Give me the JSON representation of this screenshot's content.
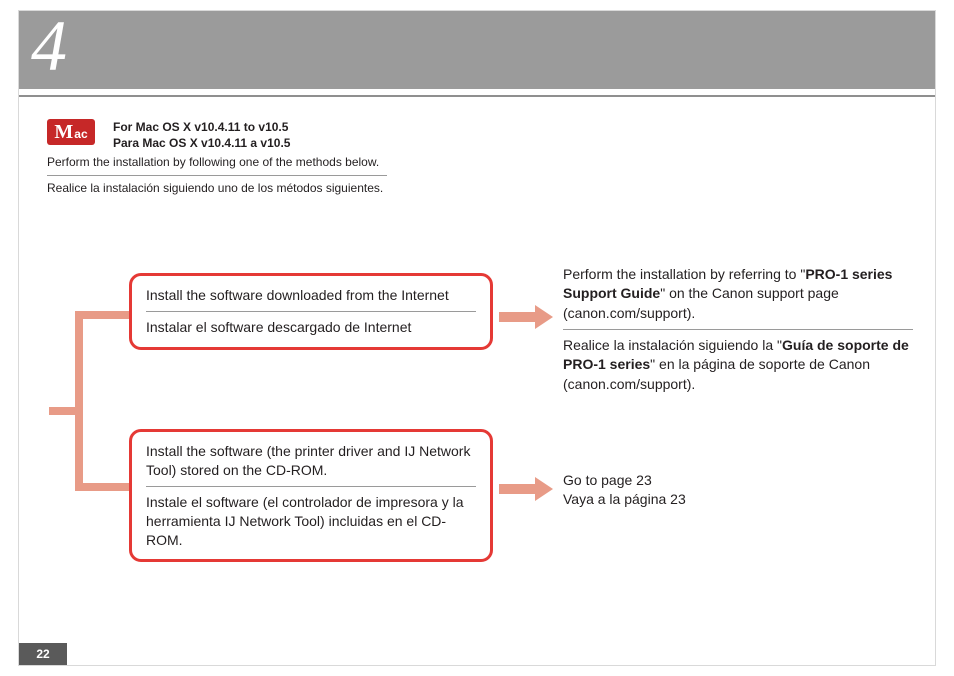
{
  "header": {
    "number": "4"
  },
  "mac_badge": {
    "M": "M",
    "ac": "ac"
  },
  "os": {
    "en": "For Mac OS X v10.4.11 to v10.5",
    "es": "Para Mac OS X v10.4.11 a v10.5"
  },
  "intro": {
    "en": "Perform the installation by following one of the methods below.",
    "es": "Realice la instalación siguiendo uno de los métodos siguientes."
  },
  "cards": {
    "top": {
      "en": "Install the software downloaded from the Internet",
      "es": "Instalar el software descargado de Internet"
    },
    "bottom": {
      "en": "Install the software (the printer driver and IJ Network Tool) stored on the CD-ROM.",
      "es": "Instale el software (el controlador de impresora y la herramienta IJ Network Tool) incluidas en el CD-ROM."
    }
  },
  "results": {
    "top": {
      "en_pre": "Perform the installation by referring to \"",
      "en_bold": "PRO-1 series Support Guide",
      "en_post": "\" on the Canon support page (canon.com/support).",
      "es_pre": "Realice la instalación siguiendo la \"",
      "es_bold": "Guía de soporte de PRO-1 series",
      "es_post": "\" en la página de soporte de Canon (canon.com/support)."
    },
    "bottom": {
      "en": "Go to page 23",
      "es": "Vaya a la página 23"
    }
  },
  "page_number": "22"
}
